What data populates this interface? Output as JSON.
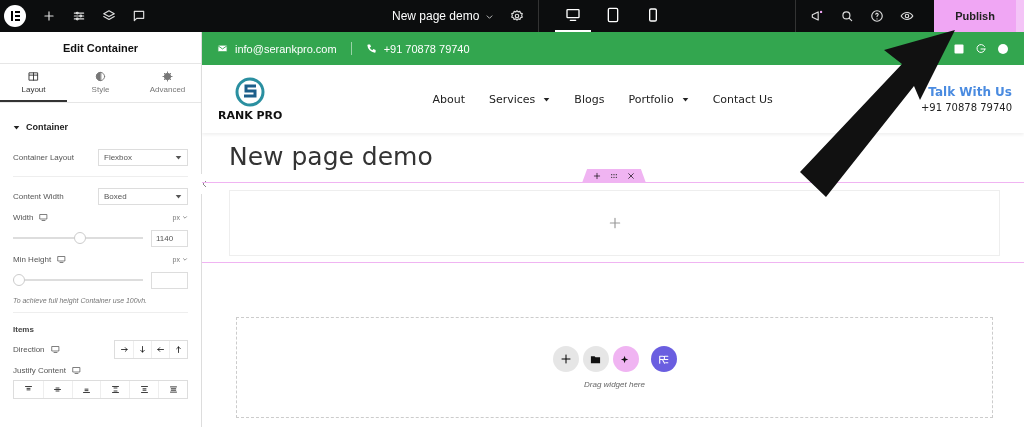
{
  "topbar": {
    "page_title": "New page demo",
    "devices": [
      {
        "kind": "desktop",
        "selected": true
      },
      {
        "kind": "tablet",
        "selected": false
      },
      {
        "kind": "mobile",
        "selected": false
      }
    ],
    "publish": "Publish"
  },
  "panel": {
    "title": "Edit Container",
    "tabs": [
      {
        "label": "Layout",
        "kind": "layout",
        "selected": true
      },
      {
        "label": "Style",
        "kind": "style",
        "selected": false
      },
      {
        "label": "Advanced",
        "kind": "advanced",
        "selected": false
      }
    ],
    "section": {
      "title": "Container",
      "expanded": true
    },
    "container_layout": {
      "label": "Container Layout",
      "value": "Flexbox"
    },
    "content_width": {
      "label": "Content Width",
      "value": "Boxed"
    },
    "width": {
      "label": "Width",
      "unit": "px",
      "level": 0.52,
      "value": "1140"
    },
    "min_height": {
      "label": "Min Height",
      "unit": "px",
      "level": 0
    },
    "note": "To achieve full height Container use 100vh.",
    "items_heading": "Items",
    "direction": {
      "label": "Direction",
      "options": [
        {
          "kind": "right",
          "selected": false
        },
        {
          "kind": "down",
          "selected": false
        },
        {
          "kind": "left",
          "selected": false
        },
        {
          "kind": "up",
          "selected": false
        }
      ]
    },
    "justify": {
      "label": "Justify Content",
      "options": [
        {
          "kind": "start",
          "selected": false
        },
        {
          "kind": "center",
          "selected": false
        },
        {
          "kind": "end",
          "selected": false
        },
        {
          "kind": "between",
          "selected": false
        },
        {
          "kind": "around",
          "selected": false
        },
        {
          "kind": "evenly",
          "selected": false
        }
      ]
    }
  },
  "site": {
    "email": "info@serankpro.com",
    "phone": "+91 70878 79740",
    "logo_text": "RANK PRO",
    "nav": [
      {
        "label": "About",
        "dropdown": false
      },
      {
        "label": "Services",
        "dropdown": true
      },
      {
        "label": "Blogs",
        "dropdown": false
      },
      {
        "label": "Portfolio",
        "dropdown": true
      },
      {
        "label": "Contact Us",
        "dropdown": false
      }
    ],
    "talk": "Talk With Us",
    "talk_phone": "+91 70878 79740",
    "heading": "New page demo",
    "drop_hint": "Drag widget here"
  }
}
